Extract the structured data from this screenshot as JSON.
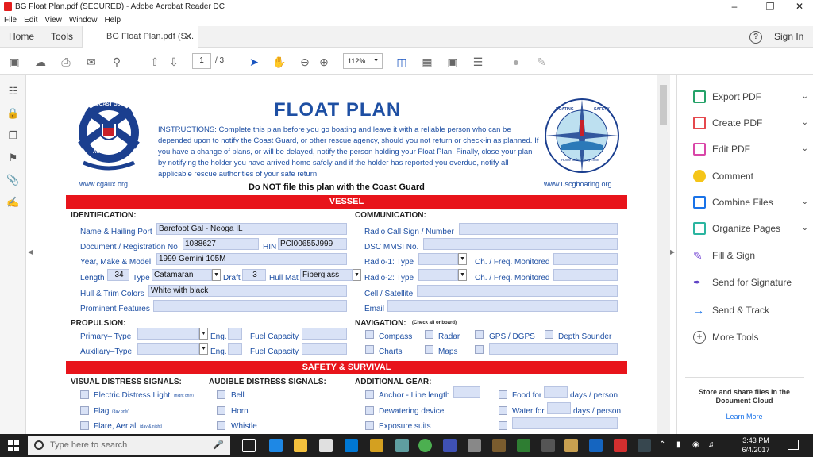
{
  "window": {
    "title": "BG Float Plan.pdf (SECURED) - Adobe Acrobat Reader DC"
  },
  "menu": [
    "File",
    "Edit",
    "View",
    "Window",
    "Help"
  ],
  "tabs": {
    "home": "Home",
    "tools": "Tools",
    "document": "BG Float Plan.pdf (S...",
    "signin": "Sign In"
  },
  "toolbar": {
    "page_current": "1",
    "page_total": "/ 3",
    "zoom": "112%"
  },
  "form": {
    "title": "FLOAT PLAN",
    "instructions": "INSTRUCTIONS: Complete this plan before you go boating and leave it with a reliable person who can be depended upon to notify the Coast Guard, or other rescue agency, should you not return or check-in as planned.  If you have a change of plans, or will be delayed, notify the person holding your Float Plan.  Finally, close your plan by notifying the holder you have arrived home safely and if the holder has reported you overdue, notify all applicable rescue authorities of your safe return.",
    "url_left": "www.cgaux.org",
    "url_right": "www.uscgboating.org",
    "donot": "Do NOT file this plan with the Coast Guard",
    "seal_left": {
      "top": "U.S. COAST GUARD",
      "bottom": "AUXILIARY"
    },
    "seal_right": {
      "top": "BOATING",
      "right": "SAFETY",
      "bottom": "Home Safe, Every Time"
    },
    "vessel_header": "VESSEL",
    "identification": "IDENTIFICATION:",
    "communication": "COMMUNICATION:",
    "labels": {
      "name": "Name & Hailing Port",
      "docreg": "Document / Registration No",
      "hin": "HIN",
      "year": "Year, Make & Model",
      "length": "Length",
      "type": "Type",
      "draft": "Draft",
      "hullmat": "Hull Mat",
      "hullcolors": "Hull & Trim Colors",
      "prominent": "Prominent Features",
      "radiocall": "Radio Call Sign / Number",
      "dsc": "DSC MMSI No.",
      "radio1": "Radio-1: Type",
      "radio2": "Radio-2: Type",
      "chfreq1": "Ch. / Freq. Monitored",
      "chfreq2": "Ch. / Freq. Monitored",
      "cell": "Cell / Satellite",
      "email": "Email"
    },
    "values": {
      "name": "Barefoot Gal - Neoga IL",
      "docreg": "1088627",
      "hin": "PCI00655J999",
      "year": "1999 Gemini 105M",
      "length": "34",
      "type": "Catamaran",
      "draft": "3",
      "hullmat": "Fiberglass",
      "hullcolors": "White with black"
    },
    "propulsion": "PROPULSION:",
    "primary_type": "Primary– Type",
    "aux_type": "Auxiliary–Type",
    "eng1": "Eng.",
    "eng2": "Eng.",
    "fuel1": "Fuel Capacity",
    "fuel2": "Fuel Capacity",
    "navigation": "NAVIGATION:",
    "nav_note": "(Check all onboard)",
    "nav_items": {
      "compass": "Compass",
      "radar": "Radar",
      "gps": "GPS / DGPS",
      "depth": "Depth Sounder",
      "charts": "Charts",
      "maps": "Maps"
    },
    "safety_header": "SAFETY & SURVIVAL",
    "visual": "VISUAL DISTRESS SIGNALS:",
    "audible": "AUDIBLE DISTRESS SIGNALS:",
    "additional": "ADDITIONAL GEAR:",
    "visual_items": {
      "electric": "Electric Distress Light",
      "electric_note": "(night only)",
      "flag": "Flag",
      "flag_note": "(day only)",
      "flare": "Flare, Aerial",
      "flare_note": "(day & night)"
    },
    "audible_items": {
      "bell": "Bell",
      "horn": "Horn",
      "whistle": "Whistle"
    },
    "gear_items": {
      "anchor": "Anchor - Line length",
      "dewater": "Dewatering device",
      "exposure": "Exposure suits",
      "food": "Food for",
      "food_days": "days / person",
      "water": "Water for",
      "water_days": "days / person"
    }
  },
  "right_panel": {
    "tools": [
      "Export PDF",
      "Create PDF",
      "Edit PDF",
      "Comment",
      "Combine Files",
      "Organize Pages",
      "Fill & Sign",
      "Send for Signature",
      "Send & Track",
      "More Tools"
    ],
    "store_text": "Store and share files in the Document Cloud",
    "learn_more": "Learn More"
  },
  "taskbar": {
    "search_placeholder": "Type here to search",
    "time": "3:43 PM",
    "date": "6/4/2017"
  },
  "colors": {
    "form_blue": "#1e4fa3",
    "red_bar": "#e8141b",
    "field_fill": "#d9e2f6"
  }
}
